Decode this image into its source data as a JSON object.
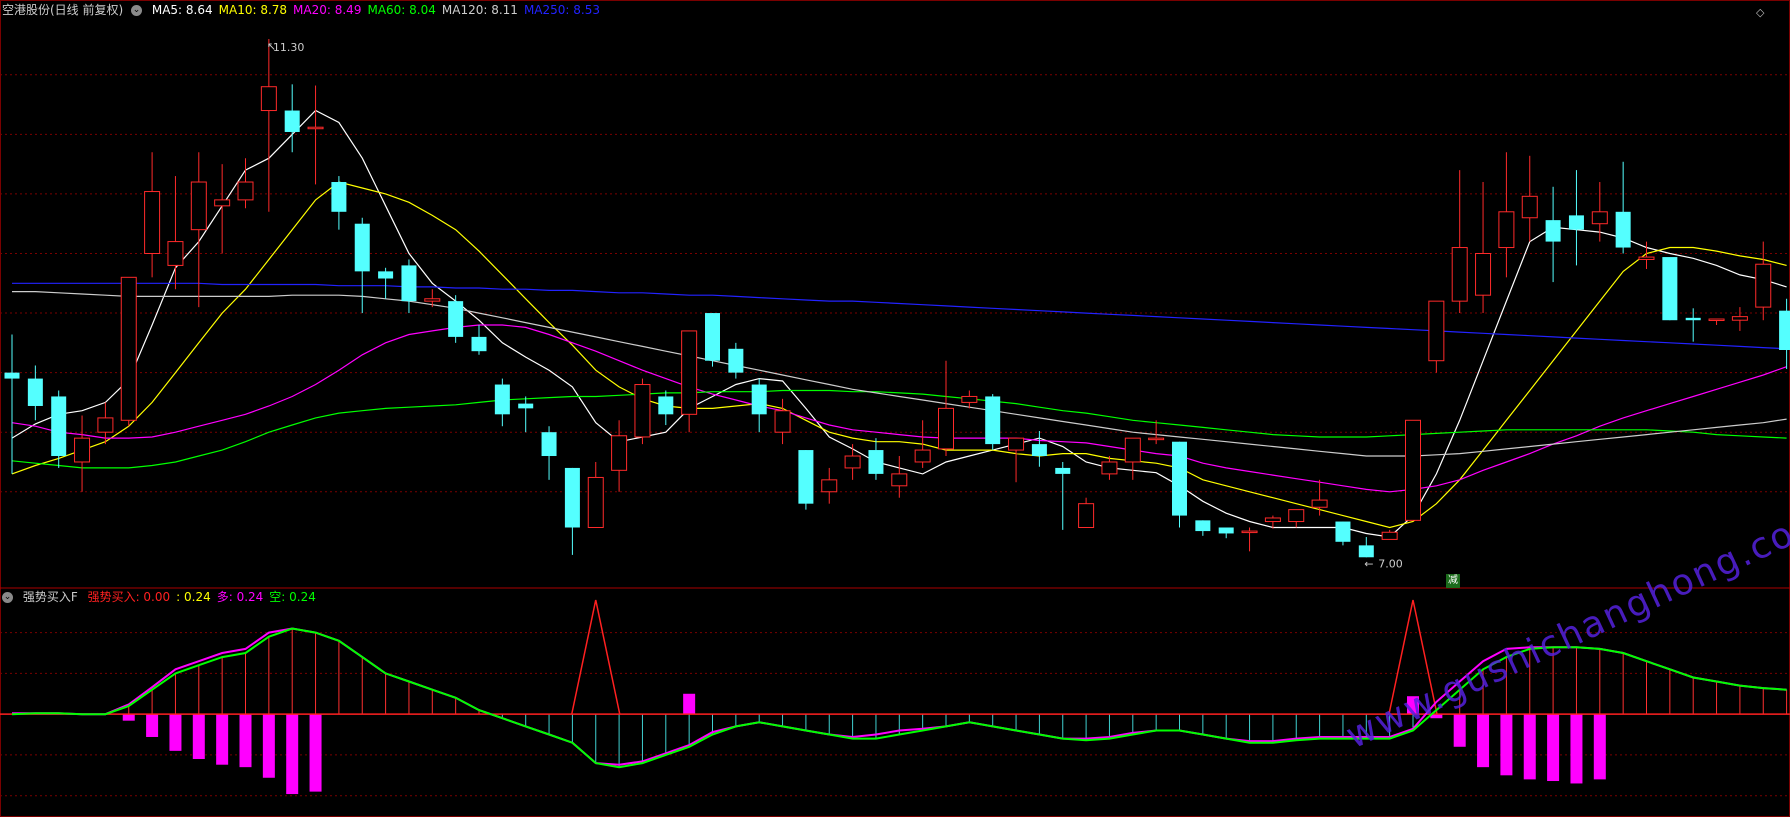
{
  "header": {
    "stock_title": "空港股份(日线 前复权)",
    "ma_labels": [
      {
        "text": "MA5: 8.64",
        "color": "#ffffff"
      },
      {
        "text": "MA10: 8.78",
        "color": "#ffff00"
      },
      {
        "text": "MA20: 8.49",
        "color": "#ff00ff"
      },
      {
        "text": "MA60: 8.04",
        "color": "#00ff00"
      },
      {
        "text": "MA120: 8.11",
        "color": "#cccccc"
      },
      {
        "text": "MA250: 8.53",
        "color": "#2222ff"
      }
    ]
  },
  "indicator_header": {
    "name": "强势买入F",
    "labels": [
      {
        "text": "强势买入: 0.00",
        "color": "#ff2020"
      },
      {
        "text": ": 0.24",
        "color": "#ffff00"
      },
      {
        "text": "多: 0.24",
        "color": "#ff00ff"
      },
      {
        "text": "空: 0.24",
        "color": "#00ff00"
      }
    ]
  },
  "annotations": {
    "high_label": "11.30",
    "low_label": "7.00",
    "jian_badge": "减"
  },
  "watermark": "www.gushichanghong.com",
  "colors": {
    "up": "#ff2a2a",
    "down": "#54ffff",
    "grid": "#7a0000",
    "ma5": "#ffffff",
    "ma10": "#ffff00",
    "ma20": "#ff00ff",
    "ma60": "#00ff00",
    "ma120": "#cccccc",
    "ma250": "#2222ff"
  },
  "chart_data": [
    {
      "type": "candlestick",
      "price_range": [
        6.86,
        11.46
      ],
      "candles": [
        [
          8.5,
          8.45,
          8.82,
          7.65
        ],
        [
          8.45,
          8.22,
          8.56,
          8.1
        ],
        [
          8.3,
          7.8,
          8.35,
          7.7
        ],
        [
          7.75,
          7.95,
          8.14,
          7.5
        ],
        [
          8.0,
          8.12,
          8.25,
          7.9
        ],
        [
          8.1,
          9.3,
          9.3,
          8.05
        ],
        [
          9.5,
          10.02,
          10.35,
          9.3
        ],
        [
          9.4,
          9.6,
          10.15,
          9.2
        ],
        [
          9.7,
          10.1,
          10.35,
          9.05
        ],
        [
          9.9,
          9.95,
          10.25,
          9.5
        ],
        [
          9.95,
          10.1,
          10.3,
          9.88
        ],
        [
          10.7,
          10.9,
          11.3,
          9.85
        ],
        [
          10.7,
          10.52,
          10.92,
          10.35
        ],
        [
          10.56,
          10.56,
          10.91,
          10.08
        ],
        [
          10.1,
          9.85,
          10.15,
          9.7
        ],
        [
          9.75,
          9.35,
          9.8,
          9.0
        ],
        [
          9.35,
          9.29,
          9.38,
          9.12
        ],
        [
          9.4,
          9.1,
          9.45,
          9.0
        ],
        [
          9.1,
          9.12,
          9.2,
          9.05
        ],
        [
          9.1,
          8.8,
          9.15,
          8.75
        ],
        [
          8.8,
          8.68,
          8.9,
          8.65
        ],
        [
          8.4,
          8.15,
          8.45,
          8.05
        ],
        [
          8.24,
          8.2,
          8.3,
          8.0
        ],
        [
          8.0,
          7.8,
          8.05,
          7.6
        ],
        [
          7.7,
          7.2,
          7.7,
          6.97
        ],
        [
          7.2,
          7.62,
          7.75,
          7.2
        ],
        [
          7.68,
          7.97,
          8.1,
          7.5
        ],
        [
          7.96,
          8.4,
          8.45,
          7.9
        ],
        [
          8.3,
          8.15,
          8.35,
          8.06
        ],
        [
          8.15,
          8.85,
          8.85,
          8.0
        ],
        [
          9.0,
          8.6,
          9.0,
          8.55
        ],
        [
          8.7,
          8.5,
          8.75,
          8.45
        ],
        [
          8.4,
          8.15,
          8.45,
          8.0
        ],
        [
          8.0,
          8.18,
          8.28,
          7.9
        ],
        [
          7.85,
          7.4,
          7.85,
          7.35
        ],
        [
          7.5,
          7.6,
          7.7,
          7.4
        ],
        [
          7.7,
          7.8,
          7.9,
          7.6
        ],
        [
          7.85,
          7.65,
          7.95,
          7.6
        ],
        [
          7.55,
          7.65,
          7.8,
          7.45
        ],
        [
          7.75,
          7.85,
          8.1,
          7.7
        ],
        [
          7.86,
          8.2,
          8.6,
          7.8
        ],
        [
          8.25,
          8.3,
          8.35,
          8.2
        ],
        [
          8.3,
          7.9,
          8.32,
          7.85
        ],
        [
          7.85,
          7.95,
          7.95,
          7.58
        ],
        [
          7.9,
          7.8,
          8.01,
          7.71
        ],
        [
          7.7,
          7.65,
          7.75,
          7.18
        ],
        [
          7.2,
          7.4,
          7.45,
          7.2
        ],
        [
          7.65,
          7.75,
          7.8,
          7.6
        ],
        [
          7.75,
          7.95,
          7.95,
          7.6
        ],
        [
          7.95,
          7.95,
          8.1,
          7.9
        ],
        [
          7.92,
          7.3,
          7.92,
          7.2
        ],
        [
          7.26,
          7.17,
          7.26,
          7.13
        ],
        [
          7.2,
          7.15,
          7.15,
          7.11
        ],
        [
          7.16,
          7.17,
          7.2,
          7.0
        ],
        [
          7.25,
          7.28,
          7.3,
          7.19
        ],
        [
          7.25,
          7.35,
          7.35,
          7.2
        ],
        [
          7.37,
          7.43,
          7.6,
          7.3
        ],
        [
          7.25,
          7.08,
          7.25,
          7.05
        ],
        [
          7.05,
          6.95,
          7.12,
          6.95
        ],
        [
          7.1,
          7.16,
          7.18,
          7.1
        ],
        [
          7.26,
          8.1,
          8.1,
          7.26
        ],
        [
          8.6,
          9.1,
          9.1,
          8.5
        ],
        [
          9.1,
          9.55,
          10.2,
          9.0
        ],
        [
          9.15,
          9.5,
          10.1,
          9.0
        ],
        [
          9.55,
          9.85,
          10.35,
          9.3
        ],
        [
          9.8,
          9.98,
          10.32,
          9.6
        ],
        [
          9.78,
          9.6,
          10.06,
          9.26
        ],
        [
          9.82,
          9.7,
          10.2,
          9.4
        ],
        [
          9.75,
          9.85,
          10.1,
          9.6
        ],
        [
          9.85,
          9.55,
          10.27,
          9.5
        ],
        [
          9.45,
          9.47,
          9.6,
          9.37
        ],
        [
          9.47,
          8.94,
          9.46,
          8.94
        ],
        [
          8.96,
          8.94,
          9.04,
          8.76
        ],
        [
          8.95,
          8.95,
          8.95,
          8.9
        ],
        [
          8.94,
          8.97,
          9.05,
          8.85
        ],
        [
          9.05,
          9.41,
          9.6,
          8.94
        ],
        [
          9.02,
          8.69,
          9.12,
          8.53
        ]
      ],
      "ma_series": {
        "MA5": [
          7.95,
          8.07,
          8.15,
          8.18,
          8.25,
          8.44,
          8.9,
          9.38,
          9.6,
          9.9,
          10.2,
          10.3,
          10.5,
          10.7,
          10.6,
          10.3,
          9.9,
          9.5,
          9.25,
          9.1,
          8.94,
          8.75,
          8.63,
          8.52,
          8.38,
          8.08,
          7.92,
          7.96,
          8.0,
          8.2,
          8.3,
          8.4,
          8.45,
          8.43,
          8.2,
          7.96,
          7.86,
          7.75,
          7.7,
          7.65,
          7.75,
          7.8,
          7.85,
          7.9,
          7.95,
          7.88,
          7.75,
          7.7,
          7.68,
          7.66,
          7.55,
          7.42,
          7.32,
          7.25,
          7.2,
          7.2,
          7.2,
          7.2,
          7.15,
          7.12,
          7.3,
          7.65,
          8.1,
          8.6,
          9.1,
          9.6,
          9.72,
          9.7,
          9.68,
          9.63,
          9.55,
          9.5,
          9.46,
          9.4,
          9.32,
          9.28,
          9.22
        ],
        "MA10": [
          7.65,
          7.72,
          7.78,
          7.85,
          7.92,
          8.05,
          8.25,
          8.5,
          8.75,
          9.0,
          9.2,
          9.45,
          9.7,
          9.95,
          10.1,
          10.05,
          10.0,
          9.93,
          9.82,
          9.7,
          9.52,
          9.32,
          9.12,
          8.92,
          8.73,
          8.52,
          8.38,
          8.28,
          8.22,
          8.2,
          8.2,
          8.22,
          8.24,
          8.2,
          8.1,
          8.0,
          7.95,
          7.92,
          7.92,
          7.9,
          7.85,
          7.85,
          7.85,
          7.82,
          7.8,
          7.82,
          7.82,
          7.78,
          7.76,
          7.74,
          7.7,
          7.6,
          7.55,
          7.5,
          7.45,
          7.4,
          7.35,
          7.3,
          7.25,
          7.2,
          7.25,
          7.4,
          7.6,
          7.85,
          8.1,
          8.35,
          8.6,
          8.85,
          9.1,
          9.35,
          9.5,
          9.55,
          9.55,
          9.52,
          9.48,
          9.45,
          9.4
        ],
        "MA20": [
          8.08,
          8.05,
          8.0,
          7.98,
          7.95,
          7.95,
          7.96,
          8.0,
          8.05,
          8.1,
          8.15,
          8.22,
          8.3,
          8.4,
          8.52,
          8.65,
          8.75,
          8.82,
          8.85,
          8.88,
          8.9,
          8.9,
          8.88,
          8.82,
          8.75,
          8.68,
          8.6,
          8.52,
          8.45,
          8.38,
          8.32,
          8.27,
          8.22,
          8.18,
          8.12,
          8.06,
          8.02,
          8.0,
          7.98,
          7.96,
          7.95,
          7.95,
          7.95,
          7.95,
          7.93,
          7.92,
          7.91,
          7.88,
          7.85,
          7.82,
          7.8,
          7.74,
          7.7,
          7.67,
          7.64,
          7.61,
          7.58,
          7.55,
          7.52,
          7.5,
          7.52,
          7.55,
          7.6,
          7.68,
          7.75,
          7.82,
          7.9,
          7.97,
          8.05,
          8.12,
          8.18,
          8.24,
          8.3,
          8.36,
          8.42,
          8.48,
          8.55
        ],
        "MA60": [
          7.76,
          7.74,
          7.72,
          7.7,
          7.7,
          7.7,
          7.72,
          7.75,
          7.8,
          7.85,
          7.92,
          8.0,
          8.06,
          8.12,
          8.16,
          8.18,
          8.2,
          8.21,
          8.22,
          8.23,
          8.25,
          8.27,
          8.28,
          8.29,
          8.3,
          8.3,
          8.31,
          8.32,
          8.33,
          8.33,
          8.34,
          8.34,
          8.34,
          8.35,
          8.35,
          8.35,
          8.34,
          8.34,
          8.33,
          8.32,
          8.3,
          8.28,
          8.26,
          8.24,
          8.21,
          8.18,
          8.16,
          8.13,
          8.1,
          8.08,
          8.06,
          8.04,
          8.02,
          8.0,
          7.98,
          7.97,
          7.96,
          7.96,
          7.96,
          7.97,
          7.98,
          7.99,
          8.0,
          8.01,
          8.02,
          8.02,
          8.02,
          8.02,
          8.02,
          8.02,
          8.02,
          8.01,
          8.0,
          7.98,
          7.97,
          7.96,
          7.95
        ],
        "MA120": [
          9.18,
          9.18,
          9.17,
          9.16,
          9.15,
          9.14,
          9.14,
          9.14,
          9.14,
          9.14,
          9.14,
          9.14,
          9.15,
          9.15,
          9.15,
          9.14,
          9.12,
          9.1,
          9.07,
          9.04,
          9.0,
          8.96,
          8.92,
          8.88,
          8.84,
          8.8,
          8.76,
          8.72,
          8.68,
          8.64,
          8.6,
          8.56,
          8.52,
          8.48,
          8.44,
          8.4,
          8.36,
          8.33,
          8.3,
          8.27,
          8.24,
          8.21,
          8.18,
          8.15,
          8.12,
          8.09,
          8.06,
          8.03,
          8.0,
          7.98,
          7.96,
          7.94,
          7.92,
          7.9,
          7.88,
          7.86,
          7.84,
          7.82,
          7.8,
          7.8,
          7.8,
          7.81,
          7.82,
          7.84,
          7.86,
          7.88,
          7.9,
          7.92,
          7.94,
          7.96,
          7.98,
          8.0,
          8.02,
          8.04,
          8.06,
          8.08,
          8.11
        ],
        "MA250": [
          9.25,
          9.25,
          9.25,
          9.25,
          9.25,
          9.25,
          9.25,
          9.25,
          9.25,
          9.24,
          9.24,
          9.24,
          9.24,
          9.24,
          9.23,
          9.23,
          9.23,
          9.22,
          9.22,
          9.21,
          9.21,
          9.2,
          9.2,
          9.19,
          9.19,
          9.18,
          9.17,
          9.17,
          9.16,
          9.15,
          9.15,
          9.14,
          9.13,
          9.12,
          9.11,
          9.1,
          9.1,
          9.09,
          9.08,
          9.07,
          9.06,
          9.05,
          9.04,
          9.03,
          9.02,
          9.01,
          9.0,
          8.99,
          8.98,
          8.97,
          8.96,
          8.95,
          8.94,
          8.93,
          8.92,
          8.91,
          8.9,
          8.89,
          8.88,
          8.87,
          8.86,
          8.85,
          8.84,
          8.83,
          8.82,
          8.81,
          8.8,
          8.79,
          8.78,
          8.77,
          8.76,
          8.75,
          8.74,
          8.73,
          8.72,
          8.71,
          8.7
        ]
      }
    },
    {
      "type": "indicator",
      "value_range": [
        -1.2,
        1.4
      ],
      "kong": [
        0.0,
        0.01,
        0.01,
        0.0,
        0.0,
        0.1,
        0.3,
        0.5,
        0.6,
        0.7,
        0.75,
        0.95,
        1.05,
        1.0,
        0.9,
        0.7,
        0.5,
        0.4,
        0.3,
        0.2,
        0.05,
        -0.05,
        -0.15,
        -0.25,
        -0.35,
        -0.6,
        -0.65,
        -0.6,
        -0.5,
        -0.4,
        -0.25,
        -0.15,
        -0.1,
        -0.15,
        -0.2,
        -0.25,
        -0.3,
        -0.3,
        -0.25,
        -0.2,
        -0.15,
        -0.1,
        -0.15,
        -0.2,
        -0.25,
        -0.3,
        -0.32,
        -0.3,
        -0.25,
        -0.2,
        -0.2,
        -0.25,
        -0.3,
        -0.35,
        -0.35,
        -0.32,
        -0.3,
        -0.3,
        -0.3,
        -0.3,
        -0.2,
        0.05,
        0.3,
        0.55,
        0.7,
        0.8,
        0.82,
        0.82,
        0.8,
        0.75,
        0.65,
        0.55,
        0.45,
        0.4,
        0.35,
        0.32,
        0.3
      ],
      "duo": [
        0.01,
        0.01,
        0.01,
        0.0,
        0.0,
        0.12,
        0.33,
        0.55,
        0.65,
        0.75,
        0.8,
        1.0,
        1.05,
        1.0,
        0.9,
        0.7,
        0.5,
        0.4,
        0.3,
        0.2,
        0.05,
        -0.05,
        -0.15,
        -0.25,
        -0.35,
        -0.6,
        -0.62,
        -0.58,
        -0.48,
        -0.38,
        -0.22,
        -0.15,
        -0.1,
        -0.15,
        -0.2,
        -0.25,
        -0.28,
        -0.25,
        -0.2,
        -0.18,
        -0.15,
        -0.1,
        -0.15,
        -0.2,
        -0.25,
        -0.3,
        -0.3,
        -0.28,
        -0.23,
        -0.2,
        -0.2,
        -0.25,
        -0.3,
        -0.33,
        -0.33,
        -0.3,
        -0.28,
        -0.28,
        -0.28,
        -0.28,
        -0.18,
        0.15,
        0.4,
        0.65,
        0.8,
        0.82,
        0.82,
        0.82,
        0.8,
        0.75,
        0.65,
        0.55,
        0.45,
        0.4,
        0.35,
        0.32,
        0.3
      ],
      "bars": [
        0,
        0,
        0,
        0,
        0,
        -0.08,
        -0.28,
        -0.45,
        -0.55,
        -0.62,
        -0.65,
        -0.78,
        -0.98,
        -0.95,
        0,
        0,
        0,
        0,
        0,
        0,
        0,
        0,
        0,
        0,
        0,
        0,
        0,
        0,
        0,
        0.25,
        0,
        0,
        0,
        0,
        0,
        0,
        0,
        0,
        0,
        0,
        0,
        0,
        0,
        0,
        0,
        0,
        0,
        0,
        0,
        0,
        0,
        0,
        0,
        0,
        0,
        0,
        0,
        0,
        0,
        0,
        0.22,
        -0.05,
        -0.4,
        -0.65,
        -0.75,
        -0.8,
        -0.82,
        -0.85,
        -0.8,
        0,
        0,
        0,
        0,
        0,
        0,
        0,
        0
      ],
      "buy_signals": [
        25,
        60
      ]
    }
  ]
}
